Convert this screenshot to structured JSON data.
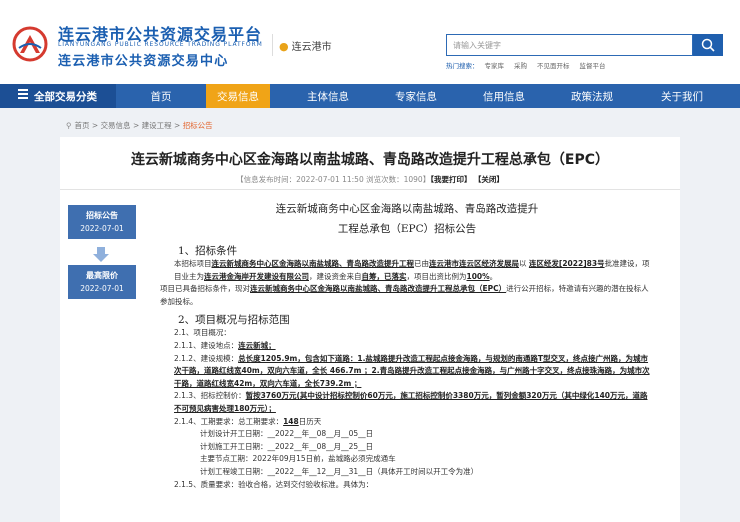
{
  "header": {
    "brand_cn": "连云港市公共资源交易平台",
    "brand_en": "LIANYUNGANG PUBLIC RESOURCE TRADING PLATFORM",
    "brand_cn2": "连云港市公共资源交易中心",
    "city": "连云港市",
    "search_placeholder": "请输入关键字",
    "hot_label": "热门搜索：",
    "hot_items": [
      "专家库",
      "采购",
      "不见面开标",
      "监督平台"
    ]
  },
  "nav": {
    "all": "全部交易分类",
    "items": [
      "首页",
      "交易信息",
      "主体信息",
      "专家信息",
      "信用信息",
      "政策法规",
      "关于我们"
    ]
  },
  "breadcrumb": [
    "首页",
    "交易信息",
    "建设工程",
    "招标公告"
  ],
  "page": {
    "title": "连云新城商务中心区金海路以南盐城路、青岛路改造提升工程总承包（EPC）",
    "meta_prefix": "【信息发布时间：2022-07-01 11:50  浏览次数：1090】",
    "print": "【我要打印】",
    "close": "【关闭】"
  },
  "timeline": [
    {
      "label": "招标公告",
      "date": "2022-07-01"
    },
    {
      "label": "最高限价",
      "date": "2022-07-01"
    }
  ],
  "doc": {
    "heading1": "连云新城商务中心区金海路以南盐城路、青岛路改造提升",
    "heading2": "工程总承包（EPC）招标公告",
    "sec1": "1、招标条件",
    "p1a": "本招标项目",
    "p1b": "连云新城商务中心区金海路以南盐城路、青岛路改造提升工程",
    "p1c": "已由",
    "p1d": "连云港市连云区经济发展局",
    "p1e": "以",
    "p1f": "连区经发[2022]83号",
    "p1g": "批准建设，项目业主为",
    "p1h": "连云港金海岸开发建设有限公司",
    "p1i": "，建设资金来自",
    "p1j": "自筹，已落实",
    "p1k": "，项目出资比例为",
    "p1l": "100%",
    "p1m": "。",
    "p2a": "项目已具备招标条件，现对",
    "p2b": "连云新城商务中心区金海路以南盐城路、青岛路改造提升工程总承包（EPC）",
    "p2c": "进行公开招标，特邀请有兴趣的潜在投标人参加投标。",
    "sec2": "2、项目概况与招标范围",
    "l1": "2.1、项目概况：",
    "l2a": "2.1.1、建设地点：",
    "l2b": "连云新城；",
    "l3a": "2.1.2、建设规模：",
    "l3b": "总长度1205.9m，包含如下道路：1.盐城路提升改造工程起点接金海路，与规划的南通路T型交叉，终点接广州路，为城市次干路，道路红线宽40m，双向六车道，全长 466.7m ；2.青岛路提升改造工程起点接金海路，与广州路十字交叉，终点接珠海路，为城市次干路，道路红线宽42m，双向六车道，全长739.2m ；",
    "l4a": "2.1.3、招标控制价：",
    "l4b": "暂按3760万元(其中设计招标控制价60万元，施工招标控制价3380万元，暂列金额320万元（其中绿化140万元，道路不可预见病害处理180万元）；",
    "l5a": "2.1.4、工期要求：总工期要求：",
    "l5b": "148",
    "l5c": "日历天",
    "d1": "计划设计开工日期：__2022__年__08__月__05__日",
    "d2": "计划施工开工日期：__2022__年__08__月__25__日",
    "d3": "主要节点工期：2022年09月15日前，盐城路必须完成通车",
    "d4": "计划工程竣工日期：__2022__年__12__月__31__日（具体开工时间以开工令为准）",
    "l6": "2.1.5、质量要求：验收合格，达到交付验收标准。具体为："
  }
}
